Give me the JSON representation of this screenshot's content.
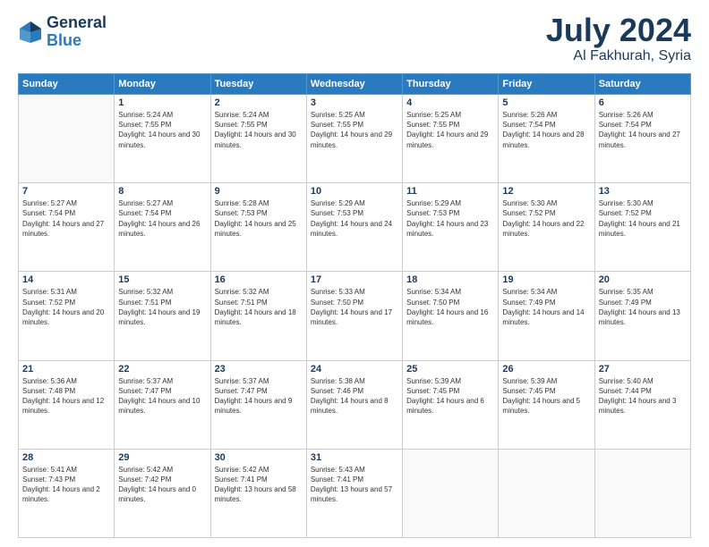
{
  "header": {
    "logo_line1": "General",
    "logo_line2": "Blue",
    "title": "July 2024",
    "location": "Al Fakhurah, Syria"
  },
  "weekdays": [
    "Sunday",
    "Monday",
    "Tuesday",
    "Wednesday",
    "Thursday",
    "Friday",
    "Saturday"
  ],
  "weeks": [
    [
      {
        "day": "",
        "sunrise": "",
        "sunset": "",
        "daylight": ""
      },
      {
        "day": "1",
        "sunrise": "Sunrise: 5:24 AM",
        "sunset": "Sunset: 7:55 PM",
        "daylight": "Daylight: 14 hours and 30 minutes."
      },
      {
        "day": "2",
        "sunrise": "Sunrise: 5:24 AM",
        "sunset": "Sunset: 7:55 PM",
        "daylight": "Daylight: 14 hours and 30 minutes."
      },
      {
        "day": "3",
        "sunrise": "Sunrise: 5:25 AM",
        "sunset": "Sunset: 7:55 PM",
        "daylight": "Daylight: 14 hours and 29 minutes."
      },
      {
        "day": "4",
        "sunrise": "Sunrise: 5:25 AM",
        "sunset": "Sunset: 7:55 PM",
        "daylight": "Daylight: 14 hours and 29 minutes."
      },
      {
        "day": "5",
        "sunrise": "Sunrise: 5:26 AM",
        "sunset": "Sunset: 7:54 PM",
        "daylight": "Daylight: 14 hours and 28 minutes."
      },
      {
        "day": "6",
        "sunrise": "Sunrise: 5:26 AM",
        "sunset": "Sunset: 7:54 PM",
        "daylight": "Daylight: 14 hours and 27 minutes."
      }
    ],
    [
      {
        "day": "7",
        "sunrise": "Sunrise: 5:27 AM",
        "sunset": "Sunset: 7:54 PM",
        "daylight": "Daylight: 14 hours and 27 minutes."
      },
      {
        "day": "8",
        "sunrise": "Sunrise: 5:27 AM",
        "sunset": "Sunset: 7:54 PM",
        "daylight": "Daylight: 14 hours and 26 minutes."
      },
      {
        "day": "9",
        "sunrise": "Sunrise: 5:28 AM",
        "sunset": "Sunset: 7:53 PM",
        "daylight": "Daylight: 14 hours and 25 minutes."
      },
      {
        "day": "10",
        "sunrise": "Sunrise: 5:29 AM",
        "sunset": "Sunset: 7:53 PM",
        "daylight": "Daylight: 14 hours and 24 minutes."
      },
      {
        "day": "11",
        "sunrise": "Sunrise: 5:29 AM",
        "sunset": "Sunset: 7:53 PM",
        "daylight": "Daylight: 14 hours and 23 minutes."
      },
      {
        "day": "12",
        "sunrise": "Sunrise: 5:30 AM",
        "sunset": "Sunset: 7:52 PM",
        "daylight": "Daylight: 14 hours and 22 minutes."
      },
      {
        "day": "13",
        "sunrise": "Sunrise: 5:30 AM",
        "sunset": "Sunset: 7:52 PM",
        "daylight": "Daylight: 14 hours and 21 minutes."
      }
    ],
    [
      {
        "day": "14",
        "sunrise": "Sunrise: 5:31 AM",
        "sunset": "Sunset: 7:52 PM",
        "daylight": "Daylight: 14 hours and 20 minutes."
      },
      {
        "day": "15",
        "sunrise": "Sunrise: 5:32 AM",
        "sunset": "Sunset: 7:51 PM",
        "daylight": "Daylight: 14 hours and 19 minutes."
      },
      {
        "day": "16",
        "sunrise": "Sunrise: 5:32 AM",
        "sunset": "Sunset: 7:51 PM",
        "daylight": "Daylight: 14 hours and 18 minutes."
      },
      {
        "day": "17",
        "sunrise": "Sunrise: 5:33 AM",
        "sunset": "Sunset: 7:50 PM",
        "daylight": "Daylight: 14 hours and 17 minutes."
      },
      {
        "day": "18",
        "sunrise": "Sunrise: 5:34 AM",
        "sunset": "Sunset: 7:50 PM",
        "daylight": "Daylight: 14 hours and 16 minutes."
      },
      {
        "day": "19",
        "sunrise": "Sunrise: 5:34 AM",
        "sunset": "Sunset: 7:49 PM",
        "daylight": "Daylight: 14 hours and 14 minutes."
      },
      {
        "day": "20",
        "sunrise": "Sunrise: 5:35 AM",
        "sunset": "Sunset: 7:49 PM",
        "daylight": "Daylight: 14 hours and 13 minutes."
      }
    ],
    [
      {
        "day": "21",
        "sunrise": "Sunrise: 5:36 AM",
        "sunset": "Sunset: 7:48 PM",
        "daylight": "Daylight: 14 hours and 12 minutes."
      },
      {
        "day": "22",
        "sunrise": "Sunrise: 5:37 AM",
        "sunset": "Sunset: 7:47 PM",
        "daylight": "Daylight: 14 hours and 10 minutes."
      },
      {
        "day": "23",
        "sunrise": "Sunrise: 5:37 AM",
        "sunset": "Sunset: 7:47 PM",
        "daylight": "Daylight: 14 hours and 9 minutes."
      },
      {
        "day": "24",
        "sunrise": "Sunrise: 5:38 AM",
        "sunset": "Sunset: 7:46 PM",
        "daylight": "Daylight: 14 hours and 8 minutes."
      },
      {
        "day": "25",
        "sunrise": "Sunrise: 5:39 AM",
        "sunset": "Sunset: 7:45 PM",
        "daylight": "Daylight: 14 hours and 6 minutes."
      },
      {
        "day": "26",
        "sunrise": "Sunrise: 5:39 AM",
        "sunset": "Sunset: 7:45 PM",
        "daylight": "Daylight: 14 hours and 5 minutes."
      },
      {
        "day": "27",
        "sunrise": "Sunrise: 5:40 AM",
        "sunset": "Sunset: 7:44 PM",
        "daylight": "Daylight: 14 hours and 3 minutes."
      }
    ],
    [
      {
        "day": "28",
        "sunrise": "Sunrise: 5:41 AM",
        "sunset": "Sunset: 7:43 PM",
        "daylight": "Daylight: 14 hours and 2 minutes."
      },
      {
        "day": "29",
        "sunrise": "Sunrise: 5:42 AM",
        "sunset": "Sunset: 7:42 PM",
        "daylight": "Daylight: 14 hours and 0 minutes."
      },
      {
        "day": "30",
        "sunrise": "Sunrise: 5:42 AM",
        "sunset": "Sunset: 7:41 PM",
        "daylight": "Daylight: 13 hours and 58 minutes."
      },
      {
        "day": "31",
        "sunrise": "Sunrise: 5:43 AM",
        "sunset": "Sunset: 7:41 PM",
        "daylight": "Daylight: 13 hours and 57 minutes."
      },
      {
        "day": "",
        "sunrise": "",
        "sunset": "",
        "daylight": ""
      },
      {
        "day": "",
        "sunrise": "",
        "sunset": "",
        "daylight": ""
      },
      {
        "day": "",
        "sunrise": "",
        "sunset": "",
        "daylight": ""
      }
    ]
  ]
}
